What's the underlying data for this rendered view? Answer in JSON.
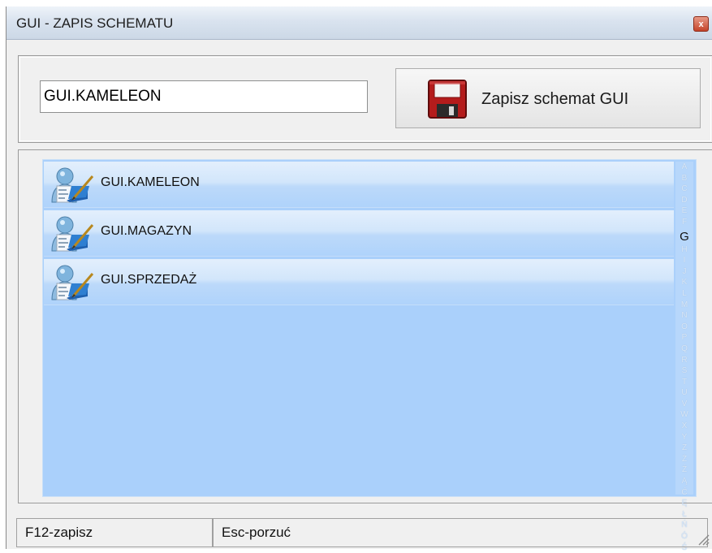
{
  "window": {
    "title": "GUI - ZAPIS SCHEMATU",
    "close_glyph": "x"
  },
  "form": {
    "name_value": "GUI.KAMELEON",
    "save_button_label": "Zapisz schemat GUI",
    "save_button_icon": "floppy-disk-icon"
  },
  "list": {
    "item_icon": "user-edit-icon",
    "items": [
      {
        "label": "GUI.KAMELEON"
      },
      {
        "label": "GUI.MAGAZYN"
      },
      {
        "label": "GUI.SPRZEDAŻ"
      }
    ]
  },
  "alphabet": {
    "before": [
      "A",
      "B",
      "C",
      "D",
      "E",
      "F"
    ],
    "active": "G",
    "after": [
      "H",
      "I",
      "J",
      "K",
      "L",
      "M",
      "N",
      "O",
      "P",
      "Q",
      "R",
      "S",
      "T",
      "U",
      "V",
      "W",
      "X",
      "Y",
      "Z",
      "Ż",
      "Ź",
      "Ą",
      "Ć",
      "Ę",
      "Ł",
      "Ń",
      "Ó",
      "Ś"
    ]
  },
  "statusbar": {
    "left": "F12-zapisz",
    "right": "Esc-porzuć"
  },
  "colors": {
    "list_background": "#aad0fb",
    "floppy_red": "#b41c1c",
    "close_button": "#c4442a"
  }
}
